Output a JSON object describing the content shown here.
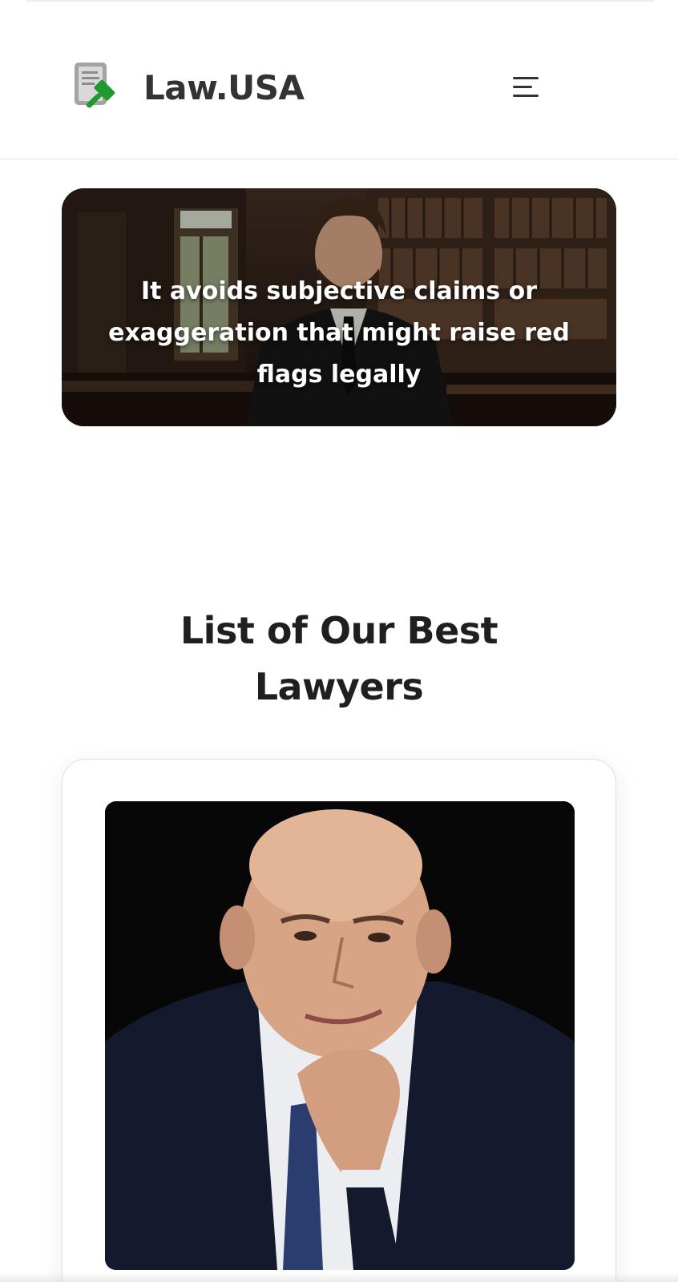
{
  "header": {
    "brand": "Law.USA",
    "logo_icon": "gavel-document-icon",
    "menu_icon": "hamburger-menu-icon"
  },
  "hero": {
    "text": "It avoids subjective claims or exaggeration that might raise red flags legally"
  },
  "lawyers_section": {
    "title": "List of Our Best Lawyers"
  },
  "colors": {
    "brand_text": "#333333",
    "logo_green": "#1f9a2e",
    "logo_gray": "#9e9e9e",
    "title_text": "#1f1f1f",
    "card_border": "#dedede"
  }
}
